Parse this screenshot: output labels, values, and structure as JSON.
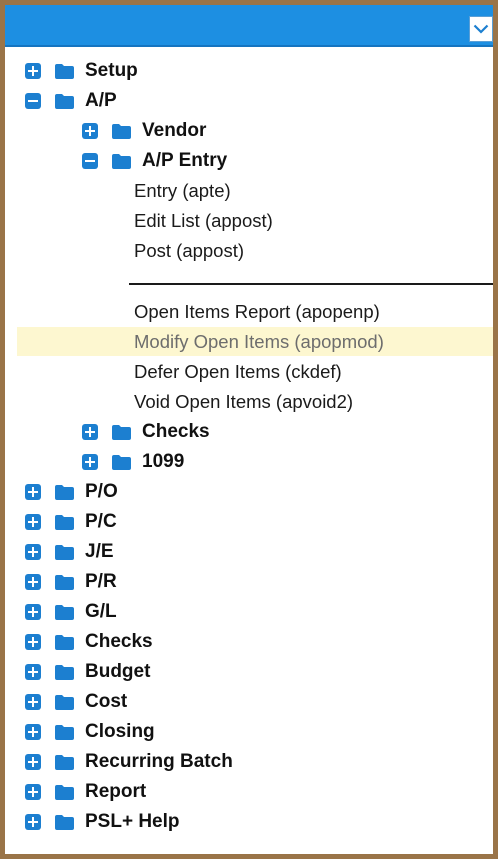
{
  "header": {
    "dropdown_icon": "chevron-down-icon"
  },
  "tree": {
    "setup": "Setup",
    "ap": "A/P",
    "vendor": "Vendor",
    "ap_entry": "A/P Entry",
    "entry_items": [
      "Entry (apte)",
      "Edit List (appost)",
      "Post (appost)"
    ],
    "open_items": [
      "Open Items Report (apopenp)",
      "Modify Open Items (apopmod)",
      "Defer Open Items (ckdef)",
      "Void Open Items (apvoid2)"
    ],
    "highlighted_item": "Modify Open Items (apopmod)",
    "ap_children_after": [
      "Checks",
      "1099"
    ],
    "top_level_after": [
      "P/O",
      "P/C",
      "J/E",
      "P/R",
      "G/L",
      "Checks",
      "Budget",
      "Cost",
      "Closing",
      "Recurring Batch",
      "Report",
      "PSL+ Help"
    ]
  },
  "colors": {
    "frame_border": "#9a7448",
    "header": "#1d8fe2",
    "toggle": "#1c7fd0",
    "folder": "#1c7fd0",
    "highlight": "#fdf7d0"
  }
}
